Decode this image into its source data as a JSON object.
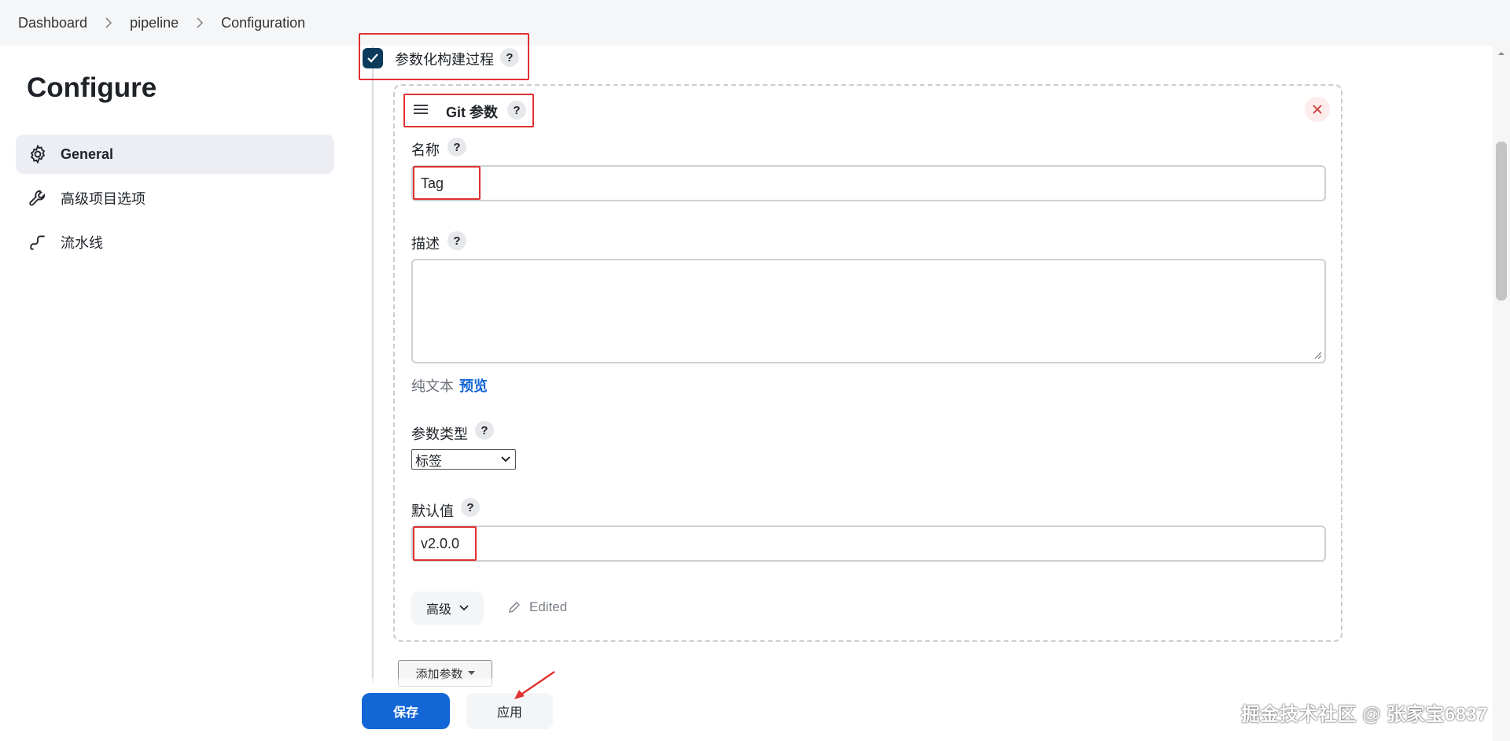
{
  "breadcrumb": [
    "Dashboard",
    "pipeline",
    "Configuration"
  ],
  "page": {
    "title": "Configure"
  },
  "sidebar": {
    "items": [
      {
        "label": "General",
        "icon": "gear-icon",
        "active": true
      },
      {
        "label": "高级项目选项",
        "icon": "wrench-icon",
        "active": false
      },
      {
        "label": "流水线",
        "icon": "pipeline-icon",
        "active": false
      }
    ]
  },
  "form": {
    "parameterized": {
      "label": "参数化构建过程",
      "checked": true
    },
    "git_param": {
      "title": "Git 参数",
      "name_label": "名称",
      "name_value": "Tag",
      "desc_label": "描述",
      "desc_value": "",
      "plain_text": "纯文本",
      "preview": "预览",
      "type_label": "参数类型",
      "type_value": "标签",
      "default_label": "默认值",
      "default_value": "v2.0.0",
      "advanced": "高级",
      "edited": "Edited"
    },
    "help": "?",
    "add_param": "添加参数"
  },
  "actions": {
    "save": "保存",
    "apply": "应用"
  },
  "watermark": "掘金技术社区 @ 张家宝6837",
  "colors": {
    "primary": "#1366d6",
    "checkbox": "#0b3a5b",
    "highlight": "#e03131"
  }
}
